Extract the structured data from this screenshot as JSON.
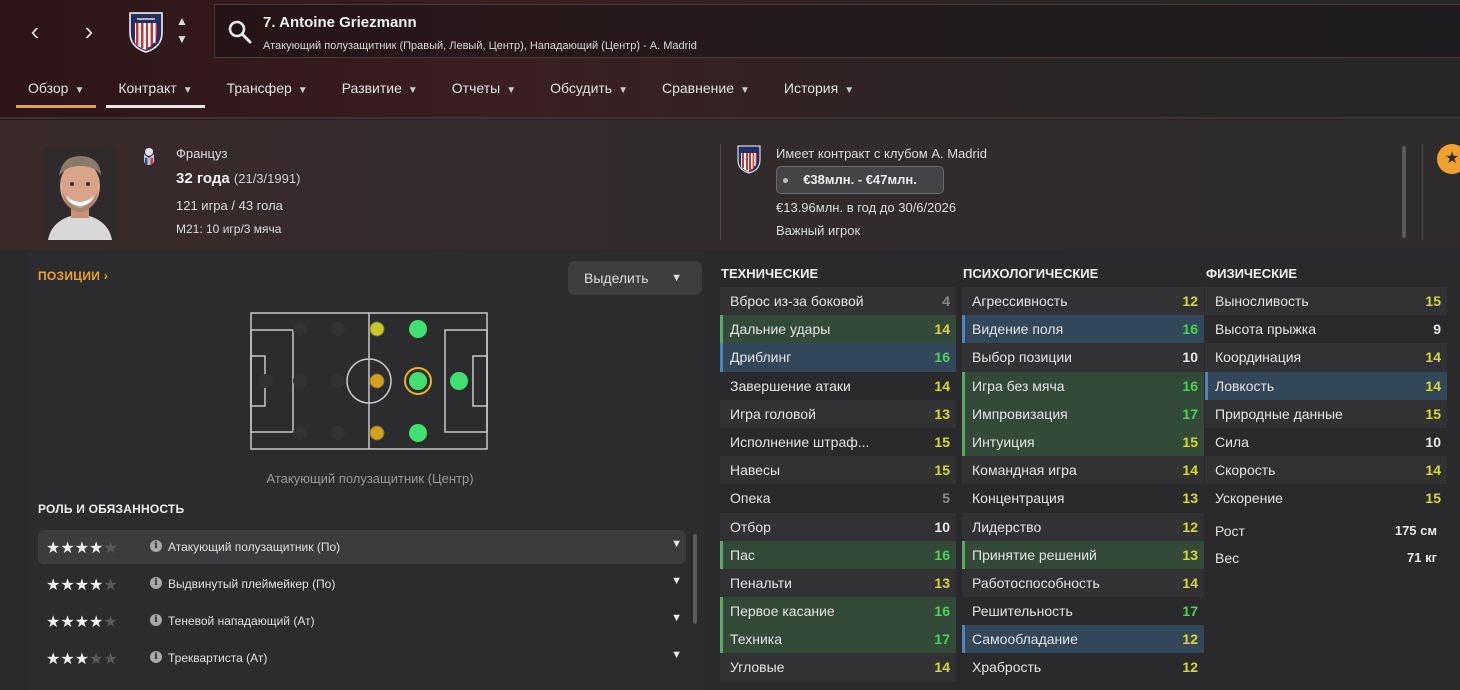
{
  "header": {
    "player_title": "7. Antoine Griezmann",
    "player_positions": "Атакующий полузащитник (Правый, Левый, Центр), Нападающий (Центр) - A. Madrid",
    "back_label": "‹",
    "forward_label": "›",
    "up_label": "▲",
    "down_label": "▼"
  },
  "tabs": [
    {
      "label": "Обзор"
    },
    {
      "label": "Контракт"
    },
    {
      "label": "Трансфер"
    },
    {
      "label": "Развитие"
    },
    {
      "label": "Отчеты"
    },
    {
      "label": "Обсудить"
    },
    {
      "label": "Сравнение"
    },
    {
      "label": "История"
    }
  ],
  "profile": {
    "nationality": "Француз",
    "age": "32 года",
    "dob": "(21/3/1991)",
    "apps_goals": "121 игра / 43 гола",
    "u21": "M21: 10 игр/3 мяча",
    "contract_club": "Имеет контракт с клубом A. Madrid",
    "value_range": "€38млн. - €47млн.",
    "wage": "€13.96млн. в год до 30/6/2026",
    "squad_status": "Важный игрок",
    "favorite_icon": "★"
  },
  "positions": {
    "title": "ПОЗИЦИИ",
    "highlight_label": "Выделить",
    "caption": "Атакующий полузащитник (Центр)"
  },
  "roles": {
    "title": "РОЛЬ И ОБЯЗАННОСТЬ",
    "items": [
      {
        "name": "Атакующий полузащитник (По)",
        "stars": 4
      },
      {
        "name": "Выдвинутый плеймейкер (По)",
        "stars": 4
      },
      {
        "name": "Теневой нападающий (Ат)",
        "stars": 4
      },
      {
        "name": "Треквар�иста (Ат)",
        "stars": 3
      }
    ]
  },
  "attributes": {
    "technical": {
      "title": "ТЕХНИЧЕСКИЕ",
      "items": [
        {
          "name": "Вброс из-за боковой",
          "value": "4"
        },
        {
          "name": "Дальние удары",
          "value": "14"
        },
        {
          "name": "Дриблинг",
          "value": "16"
        },
        {
          "name": "Завершение атаки",
          "value": "14"
        },
        {
          "name": "Игра головой",
          "value": "13"
        },
        {
          "name": "Исполнение штраф...",
          "value": "15"
        },
        {
          "name": "Навесы",
          "value": "15"
        },
        {
          "name": "Опека",
          "value": "5"
        },
        {
          "name": "Отбор",
          "value": "10"
        },
        {
          "name": "Пас",
          "value": "16"
        },
        {
          "name": "Пенальти",
          "value": "13"
        },
        {
          "name": "Первое касание",
          "value": "16"
        },
        {
          "name": "Техника",
          "value": "17"
        },
        {
          "name": "Угловые",
          "value": "14"
        }
      ]
    },
    "mental": {
      "title": "ПСИХОЛОГИЧЕСКИЕ",
      "items": [
        {
          "name": "Агрессивность",
          "value": "12"
        },
        {
          "name": "Видение поля",
          "value": "16"
        },
        {
          "name": "Выбор позиции",
          "value": "10"
        },
        {
          "name": "Игра без мяча",
          "value": "16"
        },
        {
          "name": "Импровизация",
          "value": "17"
        },
        {
          "name": "Интуиция",
          "value": "15"
        },
        {
          "name": "Командная игра",
          "value": "14"
        },
        {
          "name": "Концентрация",
          "value": "13"
        },
        {
          "name": "Лидерство",
          "value": "12"
        },
        {
          "name": "Принятие решений",
          "value": "13"
        },
        {
          "name": "Работоспособность",
          "value": "14"
        },
        {
          "name": "Решительность",
          "value": "17"
        },
        {
          "name": "Самообладание",
          "value": "12"
        },
        {
          "name": "Храбрость",
          "value": "12"
        }
      ]
    },
    "physical": {
      "title": "ФИЗИЧЕСКИЕ",
      "items": [
        {
          "name": "Выносливость",
          "value": "15"
        },
        {
          "name": "Высота прыжка",
          "value": "9"
        },
        {
          "name": "Координация",
          "value": "14"
        },
        {
          "name": "Ловкость",
          "value": "14"
        },
        {
          "name": "Природные данные",
          "value": "15"
        },
        {
          "name": "Сила",
          "value": "10"
        },
        {
          "name": "Скорость",
          "value": "14"
        },
        {
          "name": "Ускорение",
          "value": "15"
        }
      ],
      "height_label": "Рост",
      "height_value": "175 см",
      "weight_label": "Вес",
      "weight_value": "71 кг"
    }
  },
  "colors": {
    "accent": "#f0a030",
    "great": "#4ed15a",
    "good": "#d7d832",
    "club_red": "#cb3234",
    "club_blue": "#262e61"
  }
}
